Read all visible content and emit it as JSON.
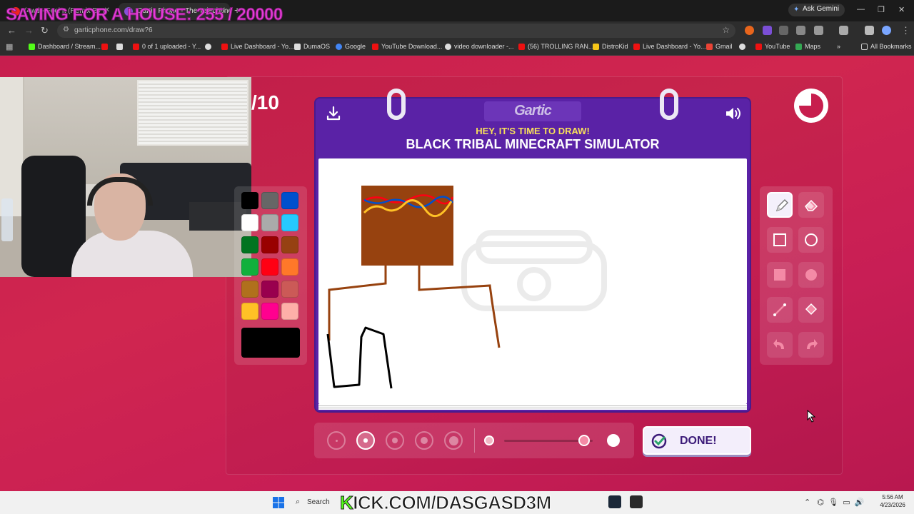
{
  "browser": {
    "tabs": [
      {
        "title": "(4wd - Feel It (Remix By L",
        "active": false
      },
      {
        "title": "Gartic Phone - The Telephone",
        "active": true
      }
    ],
    "overlay_title": "SAVING FOR A HOUSE: 255 / 20000",
    "ask_gemini": "Ask Gemini",
    "url": "garticphone.com/draw?6",
    "bookmarks": [
      {
        "label": "Dashboard / Stream...",
        "color": "#53fc18"
      },
      {
        "label": "",
        "color": "#e11"
      },
      {
        "label": "0 of 1 uploaded - Y...",
        "color": "#e11"
      },
      {
        "label": "",
        "color": "#ddd"
      },
      {
        "label": "Live Dashboard - Yo...",
        "color": "#e11"
      },
      {
        "label": "DumaOS",
        "color": "#ddd"
      },
      {
        "label": "Google",
        "color": "#4285f4"
      },
      {
        "label": "YouTube Download...",
        "color": "#e11"
      },
      {
        "label": "video downloader -...",
        "color": "#ddd"
      },
      {
        "label": "(56) TROLLING RAN...",
        "color": "#e11"
      },
      {
        "label": "DistroKid",
        "color": "#f5c518"
      },
      {
        "label": "Live Dashboard - Yo...",
        "color": "#e11"
      },
      {
        "label": "Gmail",
        "color": "#ea4335"
      },
      {
        "label": "",
        "color": "#ddd"
      },
      {
        "label": "YouTube",
        "color": "#e11"
      },
      {
        "label": "Maps",
        "color": "#34a853"
      }
    ],
    "all_bookmarks": "All Bookmarks"
  },
  "game": {
    "round": "/10",
    "logo": "Gartic",
    "prompt_header": "HEY, IT'S TIME TO DRAW!",
    "prompt": "BLACK TRIBAL MINECRAFT SIMULATOR",
    "done_label": "DONE!",
    "palette": [
      "#000000",
      "#666666",
      "#0050cd",
      "#ffffff",
      "#aaaaaa",
      "#26c9ff",
      "#017420",
      "#990000",
      "#964112",
      "#11b03c",
      "#ff0013",
      "#ff7829",
      "#b0701c",
      "#99004e",
      "#cb5a57",
      "#ffc126",
      "#ff008f",
      "#feafa8"
    ],
    "current_color": "#000000",
    "tools": [
      "pencil-icon",
      "eraser-icon",
      "rectangle-outline-icon",
      "circle-outline-icon",
      "rectangle-filled-icon",
      "circle-filled-icon",
      "line-icon",
      "fill-bucket-icon",
      "undo-icon",
      "redo-icon"
    ],
    "active_tool": "pencil-icon",
    "brush_sizes": 5,
    "active_brush": 2,
    "opacity_level": 0.9
  },
  "taskbar": {
    "search": "Search",
    "banner_k": "K",
    "banner_rest": "ICK.COM/DASGASD3M",
    "time": "5:56 AM",
    "date": "4/23/2026"
  }
}
